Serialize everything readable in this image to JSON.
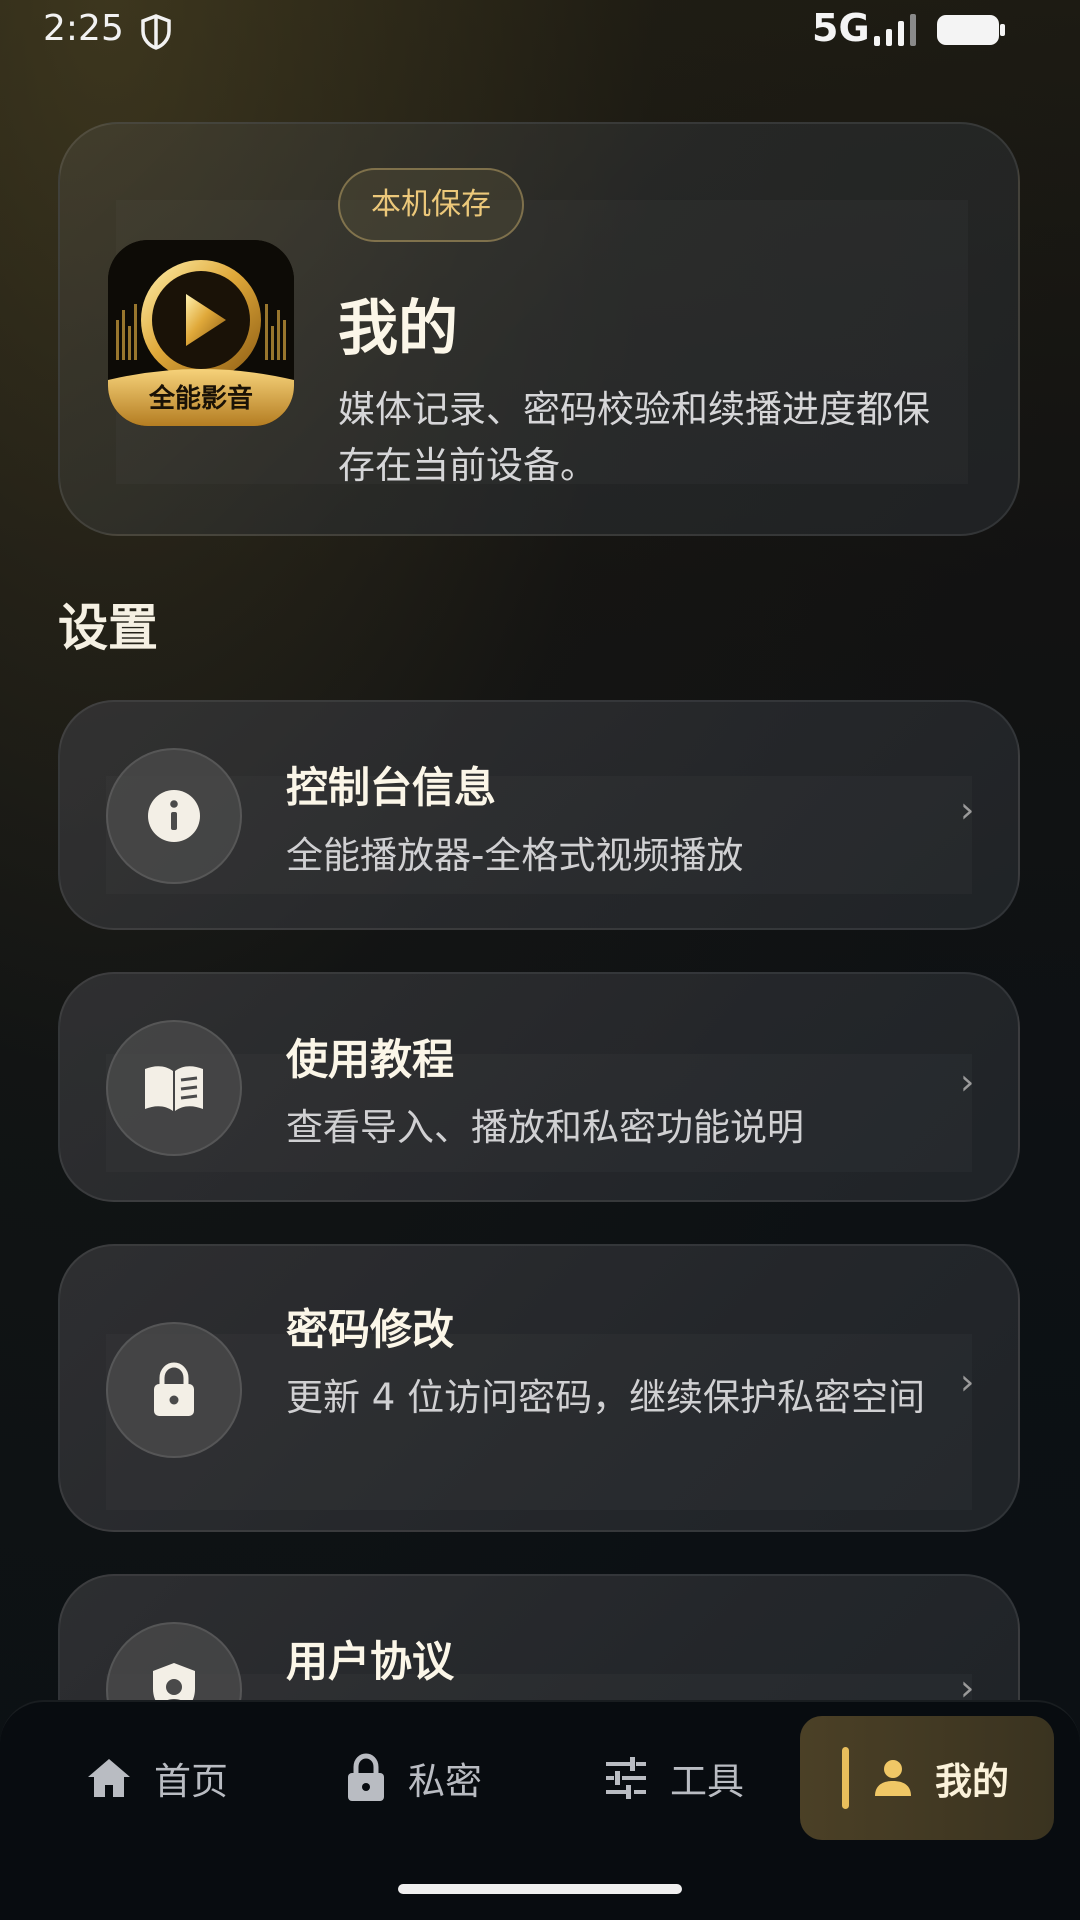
{
  "status_bar": {
    "time": "2:25",
    "network": "5G",
    "shield_icon": "shield-icon",
    "signal_icon": "signal-icon",
    "battery_icon": "battery-icon"
  },
  "profile": {
    "logo_text": "全能影音",
    "badge": "本机保存",
    "title": "我的",
    "description": "媒体记录、密码校验和续播进度都保存在当前设备。"
  },
  "section": {
    "title": "设置"
  },
  "settings": [
    {
      "icon": "info-icon",
      "title": "控制台信息",
      "subtitle": "全能播放器-全格式视频播放",
      "chevron": "›"
    },
    {
      "icon": "book-icon",
      "title": "使用教程",
      "subtitle": "查看导入、播放和私密功能说明",
      "chevron": "›"
    },
    {
      "icon": "lock-icon",
      "title": "密码修改",
      "subtitle": "更新 4 位访问密码，继续保护私密空间",
      "chevron": "›"
    },
    {
      "icon": "shield-user-icon",
      "title": "用户协议",
      "subtitle": "",
      "chevron": "›"
    }
  ],
  "nav": {
    "items": [
      {
        "icon": "home-icon",
        "label": "首页"
      },
      {
        "icon": "lock-icon",
        "label": "私密"
      },
      {
        "icon": "sliders-icon",
        "label": "工具"
      },
      {
        "icon": "person-icon",
        "label": "我的",
        "active": true
      }
    ]
  },
  "colors": {
    "accent": "#e8be5c",
    "badge_text": "#ecc87a",
    "background": "#0b1014"
  }
}
